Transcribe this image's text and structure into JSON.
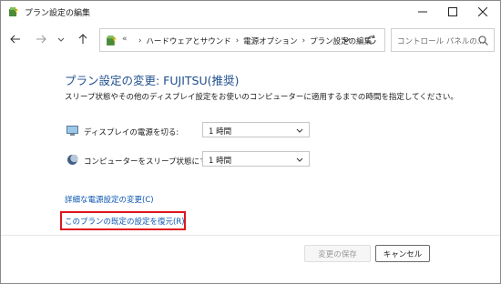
{
  "window": {
    "title": "プラン設定の編集"
  },
  "nav": {
    "more": "«",
    "breadcrumbs": [
      "ハードウェアとサウンド",
      "電源オプション",
      "プラン設定の編集"
    ],
    "search_placeholder": "コントロール パネルの..."
  },
  "main": {
    "heading": "プラン設定の変更: FUJITSU(推奨)",
    "description": "スリープ状態やその他のディスプレイ設定をお使いのコンピューターに適用するまでの時間を指定してください。",
    "settings": [
      {
        "label": "ディスプレイの電源を切る:",
        "value": "1 時間",
        "icon": "monitor-icon"
      },
      {
        "label": "コンピューターをスリープ状態にする:",
        "value": "1 時間",
        "icon": "moon-icon"
      }
    ],
    "advanced_link": "詳細な電源設定の変更(C)",
    "restore_link": "このプランの既定の設定を復元(R)"
  },
  "footer": {
    "save_label": "変更の保存",
    "cancel_label": "キャンセル"
  },
  "colors": {
    "heading": "#1e4e8c",
    "link": "#0a55b0",
    "highlight": "#e0161d"
  }
}
